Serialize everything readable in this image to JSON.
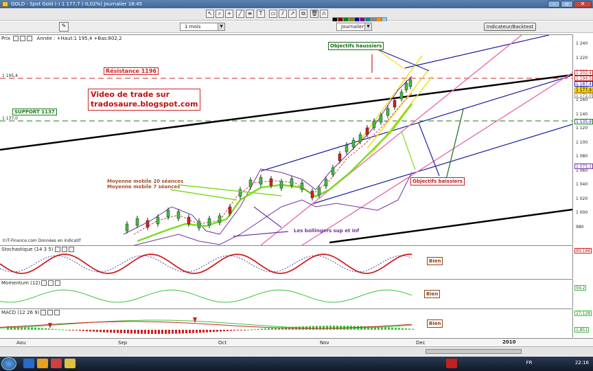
{
  "window": {
    "title": "GOLD - Spot Gold (-)   1 177,7 (-0,02%)   Journalier  18:45"
  },
  "toolbar": {
    "period": "1 mois",
    "interval": "Journalier",
    "indicators_button": "Indicateur/Backtest"
  },
  "price_pane": {
    "header": "Prix",
    "info": "Année : +Haut:1 195,4 +Bas:802,2",
    "source": "©IT-Finance.com  Données en indicatif",
    "yaxis": [
      "1 240",
      "1 220",
      "1 200",
      "1 180",
      "1 160",
      "1 140",
      "1 120",
      "1 100",
      "1 080",
      "1 060",
      "1 040",
      "1 020",
      "1 000",
      "980"
    ],
    "level_resistance": "1 195,4",
    "level_support": "1 137,0",
    "tags": {
      "t1": "1 202,4",
      "t2": "1 194,5",
      "t3": "1 187,4",
      "t4": "1 177,9",
      "t5": "1 172,0",
      "t6": "1 135,9",
      "t7": "1 075,1"
    },
    "annotations": {
      "resistance": "Résistance 1196",
      "support": "SUPPORT 1137",
      "video_line1": "Video de trade sur",
      "video_line2": "tradosaure.blogspot.com",
      "objectifs_haussiers": "Objectifs haussiers",
      "objectifs_baissiers": "Objectifs baissiers",
      "mm20": "Moyenne mobile 20 séances",
      "mm7": "Moyenne mobile 7 séances",
      "bollingers": "Les bollingers sup et inf"
    }
  },
  "stoch_pane": {
    "header": "Stochastique (14 3 5)",
    "value": "89,188",
    "note": "Bien"
  },
  "momentum_pane": {
    "header": "Momentum (12)",
    "value": "59,2",
    "note": "Bien"
  },
  "macd_pane": {
    "header": "MACD (12 26 9)",
    "value1": "27,128",
    "value2": "1,851",
    "note": "Bien"
  },
  "xaxis": {
    "labels": [
      "Aou",
      "Sep",
      "Oct",
      "Nov",
      "Dec"
    ],
    "year": "2010"
  },
  "taskbar": {
    "lang": "FR",
    "time": "22:16"
  },
  "colors": {
    "resistance": "#d02020",
    "support": "#1a7a1a",
    "bull": "#1a6a1a",
    "bear": "#c02020",
    "bollinger": "#7030a0",
    "mm20": "#7ddc1f",
    "mm7": "#d04040",
    "channel": "#1a1aa0",
    "fan_yellow": "#f0e020",
    "fan_pink": "#e878b0"
  }
}
